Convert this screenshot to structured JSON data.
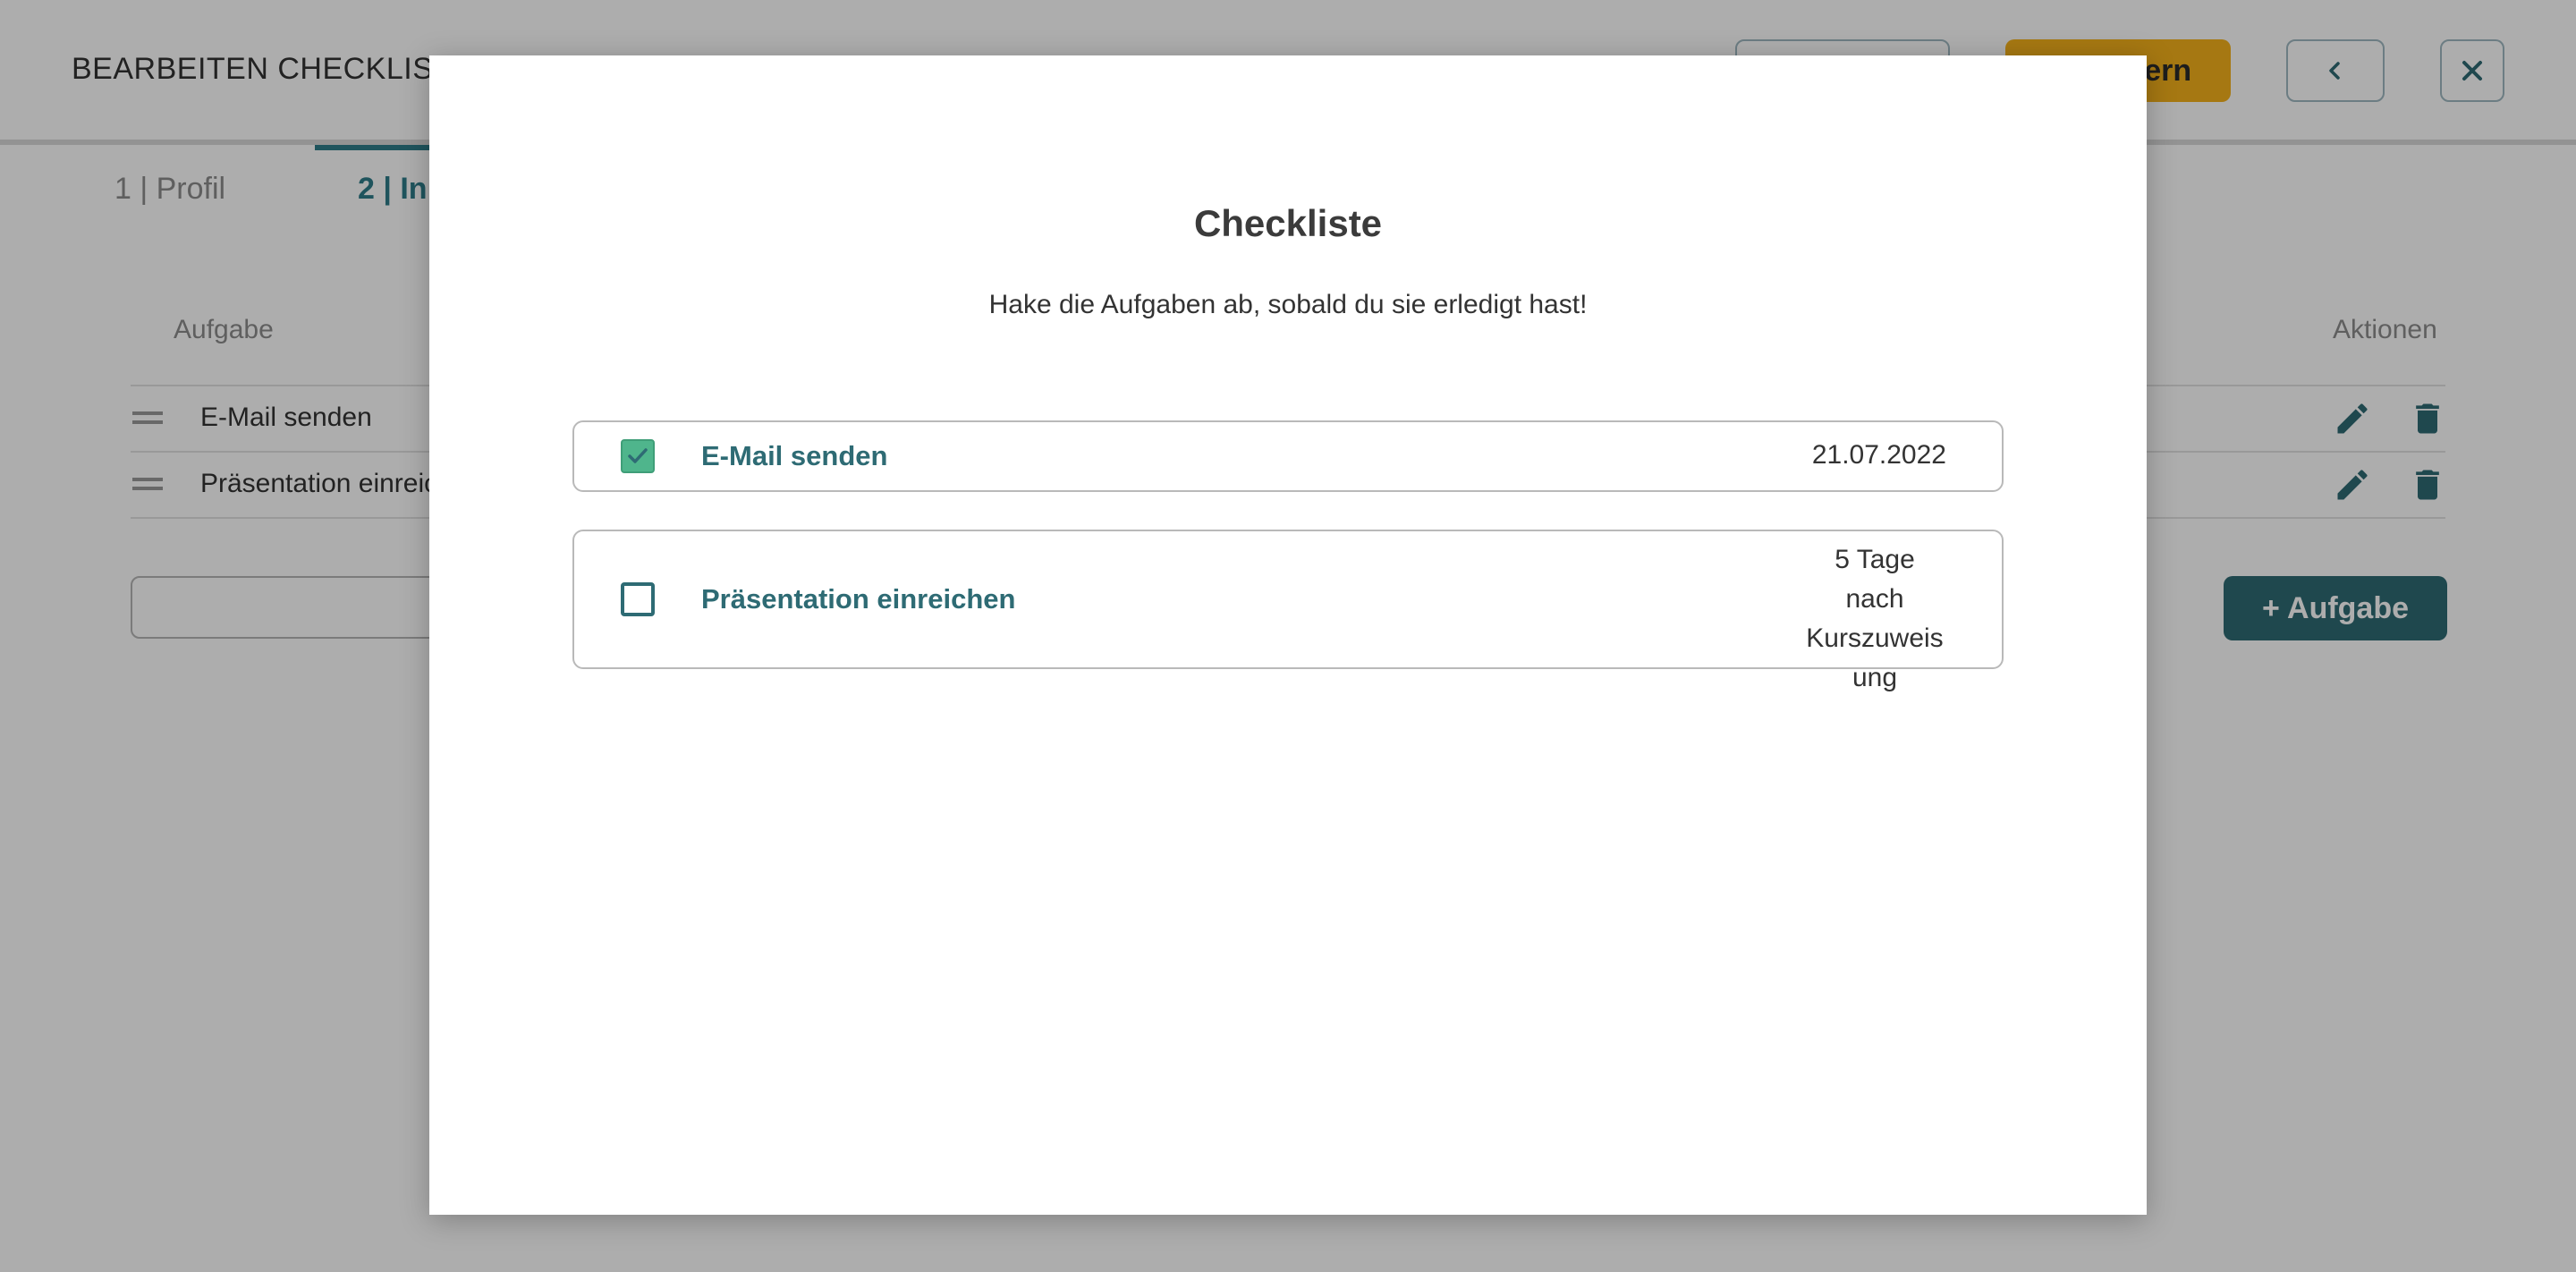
{
  "page": {
    "title": "BEARBEITEN CHECKLISTE | C",
    "save_label": "Speichern",
    "tabs": [
      {
        "label": "1 | Profil"
      },
      {
        "label": "2 | In"
      }
    ],
    "table": {
      "col_task": "Aufgabe",
      "col_actions": "Aktionen",
      "rows": [
        {
          "task": "E-Mail senden"
        },
        {
          "task": "Präsentation einreic"
        }
      ]
    },
    "add_task_label": "+ Aufgabe"
  },
  "modal": {
    "title": "Checkliste",
    "subtitle": "Hake die Aufgaben ab, sobald du sie erledigt hast!",
    "tasks": [
      {
        "name": "E-Mail senden",
        "due": "21.07.2022",
        "checked": true
      },
      {
        "name": "Präsentation einreichen",
        "due_lines": [
          "5 Tage nach",
          "Kurszuweis",
          "ung"
        ],
        "checked": false
      }
    ]
  },
  "colors": {
    "accent": "#2e6b74",
    "save_button": "#f5b21b",
    "checked": "#4fb58c"
  },
  "icons": [
    "chevron-left-icon",
    "close-icon",
    "drag-handle-icon",
    "edit-icon",
    "trash-icon",
    "check-icon"
  ]
}
